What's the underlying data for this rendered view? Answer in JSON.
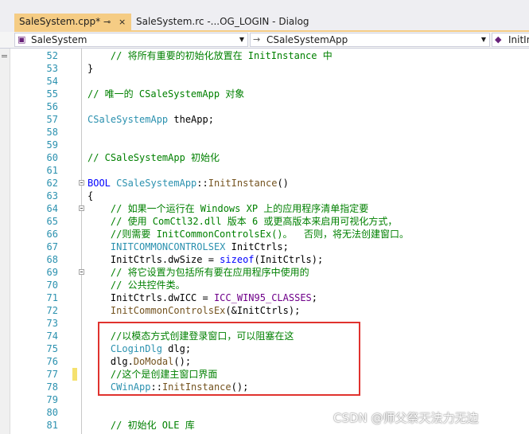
{
  "tabs": [
    {
      "label": "SaleSystem.cpp*",
      "pin": "⊸",
      "close": "×",
      "active": true
    },
    {
      "label": "SaleSystem.rc -...OG_LOGIN - Dialog",
      "active": false
    }
  ],
  "nav": {
    "project": "SaleSystem",
    "class": "CSaleSystemApp",
    "member": "InitInst"
  },
  "colors": {
    "tab_active": "#f5cc84",
    "line_number": "#2b91af",
    "comment": "#008000",
    "keyword": "#0000ff",
    "type": "#2b91af",
    "function": "#74531f",
    "macro": "#6f008a",
    "highlight_box": "#e0322e",
    "change_marker": "#f5e16e"
  },
  "lines": [
    {
      "num": "52",
      "tokens": [
        {
          "t": "    "
        },
        {
          "t": "// 将所有重要的初始化放置在 InitInstance 中",
          "c": "cm"
        }
      ]
    },
    {
      "num": "53",
      "tokens": [
        {
          "t": "}"
        }
      ]
    },
    {
      "num": "54",
      "tokens": []
    },
    {
      "num": "55",
      "tokens": [
        {
          "t": "// 唯一的 CSaleSystemApp 对象",
          "c": "cm"
        }
      ]
    },
    {
      "num": "56",
      "tokens": []
    },
    {
      "num": "57",
      "tokens": [
        {
          "t": "CSaleSystemApp",
          "c": "ty"
        },
        {
          "t": " theApp;"
        }
      ]
    },
    {
      "num": "58",
      "tokens": []
    },
    {
      "num": "59",
      "tokens": []
    },
    {
      "num": "60",
      "tokens": [
        {
          "t": "// CSaleSystemApp 初始化",
          "c": "cm"
        }
      ]
    },
    {
      "num": "61",
      "tokens": []
    },
    {
      "num": "62",
      "fold": true,
      "tokens": [
        {
          "t": "BOOL",
          "c": "kw"
        },
        {
          "t": " "
        },
        {
          "t": "CSaleSystemApp",
          "c": "ty"
        },
        {
          "t": "::"
        },
        {
          "t": "InitInstance",
          "c": "fn"
        },
        {
          "t": "()"
        }
      ]
    },
    {
      "num": "63",
      "tokens": [
        {
          "t": "{"
        }
      ]
    },
    {
      "num": "64",
      "fold": true,
      "tokens": [
        {
          "t": "    "
        },
        {
          "t": "// 如果一个运行在 Windows XP 上的应用程序清单指定要",
          "c": "cm"
        }
      ]
    },
    {
      "num": "65",
      "tokens": [
        {
          "t": "    "
        },
        {
          "t": "// 使用 ComCtl32.dll 版本 6 或更高版本来启用可视化方式，",
          "c": "cm"
        }
      ]
    },
    {
      "num": "66",
      "tokens": [
        {
          "t": "    "
        },
        {
          "t": "//则需要 InitCommonControlsEx()。  否则，将无法创建窗口。",
          "c": "cm"
        }
      ]
    },
    {
      "num": "67",
      "tokens": [
        {
          "t": "    "
        },
        {
          "t": "INITCOMMONCONTROLSEX",
          "c": "ty"
        },
        {
          "t": " InitCtrls;"
        }
      ]
    },
    {
      "num": "68",
      "tokens": [
        {
          "t": "    InitCtrls.dwSize = "
        },
        {
          "t": "sizeof",
          "c": "kw"
        },
        {
          "t": "(InitCtrls);"
        }
      ]
    },
    {
      "num": "69",
      "fold": true,
      "tokens": [
        {
          "t": "    "
        },
        {
          "t": "// 将它设置为包括所有要在应用程序中使用的",
          "c": "cm"
        }
      ]
    },
    {
      "num": "70",
      "tokens": [
        {
          "t": "    "
        },
        {
          "t": "// 公共控件类。",
          "c": "cm"
        }
      ]
    },
    {
      "num": "71",
      "tokens": [
        {
          "t": "    InitCtrls.dwICC = "
        },
        {
          "t": "ICC_WIN95_CLASSES",
          "c": "mc"
        },
        {
          "t": ";"
        }
      ]
    },
    {
      "num": "72",
      "tokens": [
        {
          "t": "    "
        },
        {
          "t": "InitCommonControlsEx",
          "c": "fn"
        },
        {
          "t": "(&InitCtrls);"
        }
      ]
    },
    {
      "num": "73",
      "tokens": []
    },
    {
      "num": "74",
      "tokens": [
        {
          "t": "    "
        },
        {
          "t": "//以模态方式创建登录窗口，可以阻塞在这",
          "c": "cm"
        }
      ]
    },
    {
      "num": "75",
      "tokens": [
        {
          "t": "    "
        },
        {
          "t": "CLoginDlg",
          "c": "ty"
        },
        {
          "t": " dlg;"
        }
      ]
    },
    {
      "num": "76",
      "tokens": [
        {
          "t": "    dlg."
        },
        {
          "t": "DoModal",
          "c": "fn"
        },
        {
          "t": "();"
        }
      ]
    },
    {
      "num": "77",
      "tokens": [
        {
          "t": "    "
        },
        {
          "t": "//这个是创建主窗口界面",
          "c": "cm"
        }
      ]
    },
    {
      "num": "78",
      "tokens": [
        {
          "t": "    "
        },
        {
          "t": "CWinApp",
          "c": "ty"
        },
        {
          "t": "::"
        },
        {
          "t": "InitInstance",
          "c": "fn"
        },
        {
          "t": "();"
        }
      ]
    },
    {
      "num": "79",
      "tokens": []
    },
    {
      "num": "80",
      "tokens": []
    },
    {
      "num": "81",
      "tokens": [
        {
          "t": "    "
        },
        {
          "t": "// 初始化 OLE 库",
          "c": "cm"
        }
      ]
    }
  ],
  "watermark": "CSDN @师父祭天法力无边"
}
